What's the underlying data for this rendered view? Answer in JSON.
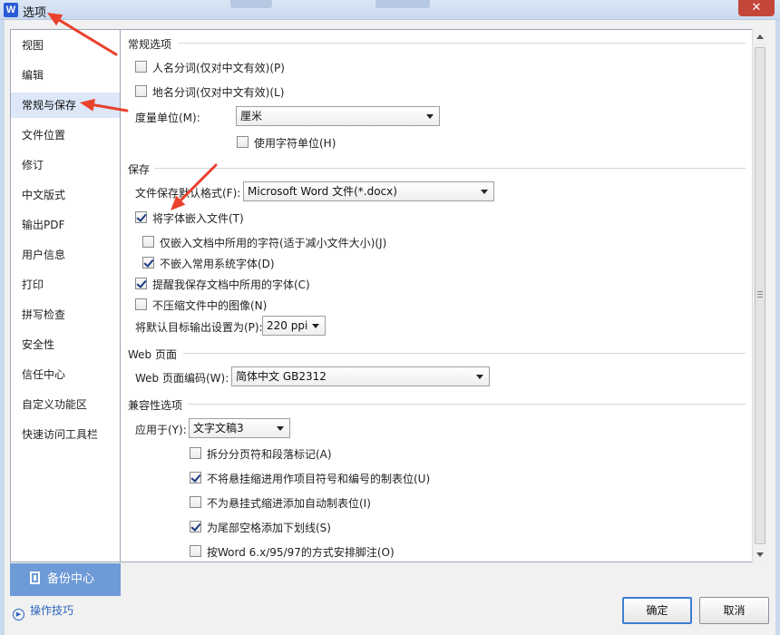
{
  "window": {
    "title": "选项",
    "logo_letter": "W",
    "close_glyph": "✕"
  },
  "sidebar": {
    "items": [
      {
        "label": "视图"
      },
      {
        "label": "编辑"
      },
      {
        "label": "常规与保存"
      },
      {
        "label": "文件位置"
      },
      {
        "label": "修订"
      },
      {
        "label": "中文版式"
      },
      {
        "label": "输出PDF"
      },
      {
        "label": "用户信息"
      },
      {
        "label": "打印"
      },
      {
        "label": "拼写检查"
      },
      {
        "label": "安全性"
      },
      {
        "label": "信任中心"
      },
      {
        "label": "自定义功能区"
      },
      {
        "label": "快速访问工具栏"
      }
    ],
    "active_index": 2,
    "backup_label": "备份中心",
    "tips_label": "操作技巧"
  },
  "general": {
    "title": "常规选项",
    "name_split": {
      "label": "人名分词(仅对中文有效)(P)",
      "checked": false
    },
    "place_split": {
      "label": "地名分词(仅对中文有效)(L)",
      "checked": false
    },
    "unit_label": "度量单位(M):",
    "unit_value": "厘米",
    "char_unit": {
      "label": "使用字符单位(H)",
      "checked": false
    }
  },
  "save": {
    "title": "保存",
    "format_label": "文件保存默认格式(F):",
    "format_value": "Microsoft Word 文件(*.docx)",
    "embed_fonts": {
      "label": "将字体嵌入文件(T)",
      "checked": true
    },
    "embed_used_only": {
      "label": "仅嵌入文档中所用的字符(适于减小文件大小)(J)",
      "checked": false
    },
    "no_system_fonts": {
      "label": "不嵌入常用系统字体(D)",
      "checked": true
    },
    "remind_fonts": {
      "label": "提醒我保存文档中所用的字体(C)",
      "checked": true
    },
    "no_compress": {
      "label": "不压缩文件中的图像(N)",
      "checked": false
    },
    "output_label": "将默认目标输出设置为(P):",
    "output_value": "220 ppi"
  },
  "web": {
    "title": "Web 页面",
    "encoding_label": "Web 页面编码(W):",
    "encoding_value": "简体中文 GB2312"
  },
  "compat": {
    "title": "兼容性选项",
    "apply_label": "应用于(Y):",
    "apply_value": "文字文稿3",
    "options": [
      {
        "label": "拆分分页符和段落标记(A)",
        "checked": false
      },
      {
        "label": "不将悬挂缩进用作项目符号和编号的制表位(U)",
        "checked": true
      },
      {
        "label": "不为悬挂式缩进添加自动制表位(I)",
        "checked": false
      },
      {
        "label": "为尾部空格添加下划线(S)",
        "checked": true
      },
      {
        "label": "按Word 6.x/95/97的方式安排脚注(O)",
        "checked": false
      }
    ]
  },
  "buttons": {
    "ok": "确定",
    "cancel": "取消"
  },
  "annotation_color": "#e8412c"
}
